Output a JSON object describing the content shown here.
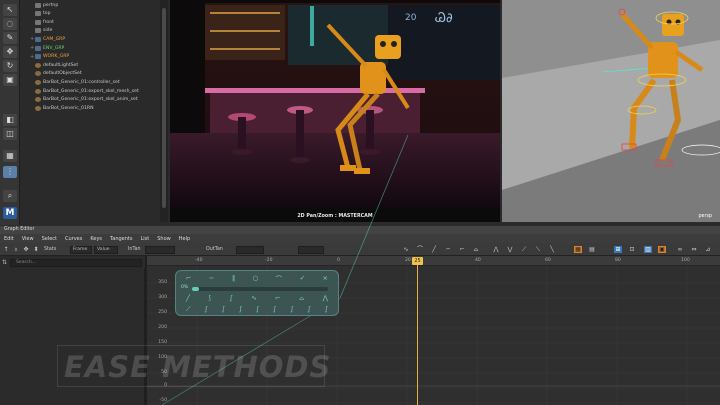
{
  "outliner": {
    "items": [
      {
        "label": "pertnp",
        "style": "plain",
        "kind": "obj"
      },
      {
        "label": "top",
        "style": "plain",
        "kind": "obj"
      },
      {
        "label": "front",
        "style": "plain",
        "kind": "obj"
      },
      {
        "label": "side",
        "style": "plain",
        "kind": "obj"
      },
      {
        "label": "CAM_GRP",
        "style": "orange",
        "kind": "grp"
      },
      {
        "label": "ENV_GRP",
        "style": "green",
        "kind": "grp"
      },
      {
        "label": "WORK_GRP",
        "style": "orange",
        "kind": "grp"
      },
      {
        "label": "defaultLightSet",
        "style": "plain",
        "kind": "set"
      },
      {
        "label": "defaultObjectSet",
        "style": "plain",
        "kind": "set"
      },
      {
        "label": "BarBot_Generic_01:controller_set",
        "style": "plain",
        "kind": "set"
      },
      {
        "label": "BarBot_Generic_01:export_skel_mesh_set",
        "style": "plain",
        "kind": "set"
      },
      {
        "label": "BarBot_Generic_01:export_skel_anim_set",
        "style": "plain",
        "kind": "set"
      },
      {
        "label": "BarBot_Generic_01RN",
        "style": "plain",
        "kind": "set"
      }
    ]
  },
  "viewports": {
    "camera_label": "2D Pan/Zoom : MASTERCAM",
    "persp_label": "persp"
  },
  "graph_editor": {
    "title": "Graph Editor",
    "menu": [
      "Edit",
      "View",
      "Select",
      "Curves",
      "Keys",
      "Tangents",
      "List",
      "Show",
      "Help"
    ],
    "toolbar": {
      "stats_label": "Stats",
      "frame_field": "Frame",
      "value_field": "Value",
      "in_tan_label": "InTan",
      "out_tan_label": "OutTan"
    },
    "search_placeholder": "Search...",
    "ruler": [
      "-40",
      "-20",
      "0",
      "20",
      "40",
      "60",
      "80",
      "100"
    ],
    "values": [
      "350",
      "300",
      "250",
      "200",
      "150",
      "100",
      "50",
      "0",
      "-50"
    ],
    "current_frame": "25"
  },
  "ease_panel": {
    "slider_label": "0%",
    "slider_value": 0.05,
    "accent": "#6bd8c6"
  },
  "watermark": "EASE METHODS",
  "colors": {
    "playhead": "#f0c24a",
    "highlight_orange": "#d9832e",
    "selection_blue": "#3a78b5",
    "group_green": "#6fd17a",
    "group_orange": "#f0a040"
  }
}
